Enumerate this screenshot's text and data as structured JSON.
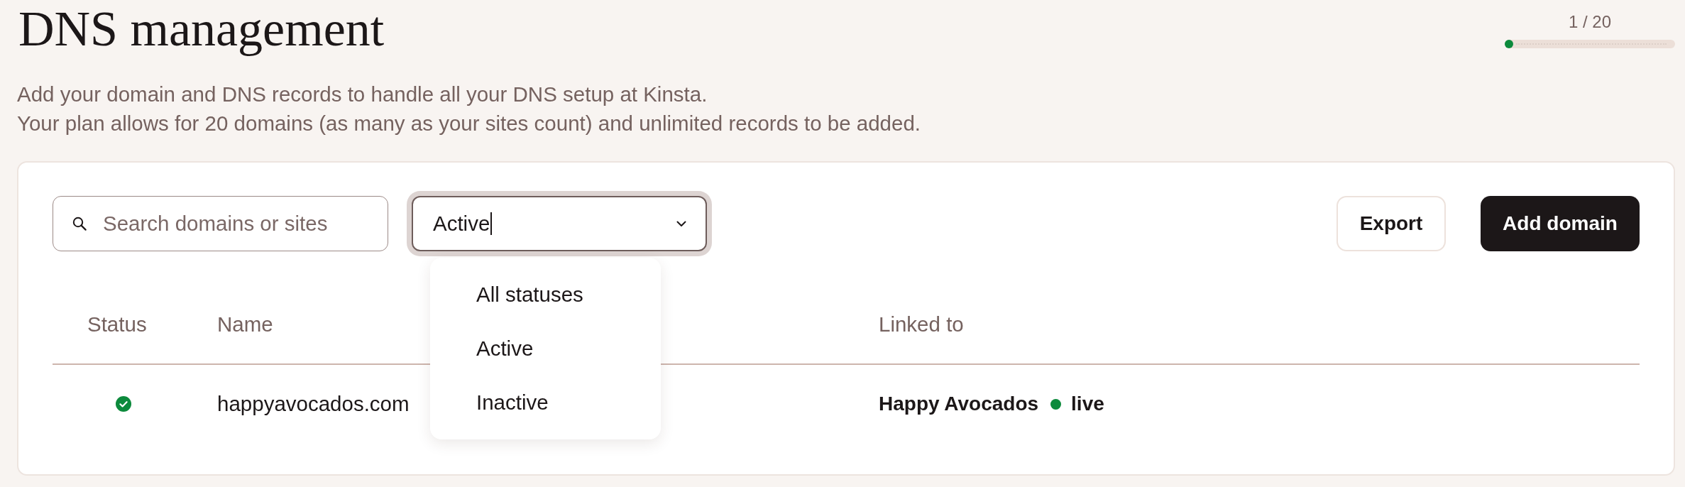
{
  "page": {
    "title": "DNS management",
    "description": [
      "Add your domain and DNS records to handle all your DNS setup at Kinsta.",
      "Your plan allows for 20 domains (as many as your sites count) and unlimited records to be added."
    ]
  },
  "usage": {
    "label": "1 / 20",
    "level": 0.05
  },
  "toolbar": {
    "search": {
      "placeholder": "Search domains or sites"
    },
    "status_filter": {
      "value": "Active",
      "expanded": true,
      "options": [
        {
          "label": "All statuses"
        },
        {
          "label": "Active"
        },
        {
          "label": "Inactive"
        }
      ]
    },
    "buttons": [
      {
        "label": "Export",
        "kind": "secondary"
      },
      {
        "label": "Add domain",
        "kind": "primary"
      }
    ]
  },
  "table": {
    "columns": [
      {
        "label": "Status"
      },
      {
        "label": "Name"
      },
      {
        "label": "Linked to"
      }
    ],
    "rows": [
      {
        "active": true,
        "name": "happyavocados.com",
        "linked_to": {
          "site": "Happy Avocados",
          "environment": "live",
          "color": "#0c8a3c"
        }
      }
    ]
  }
}
